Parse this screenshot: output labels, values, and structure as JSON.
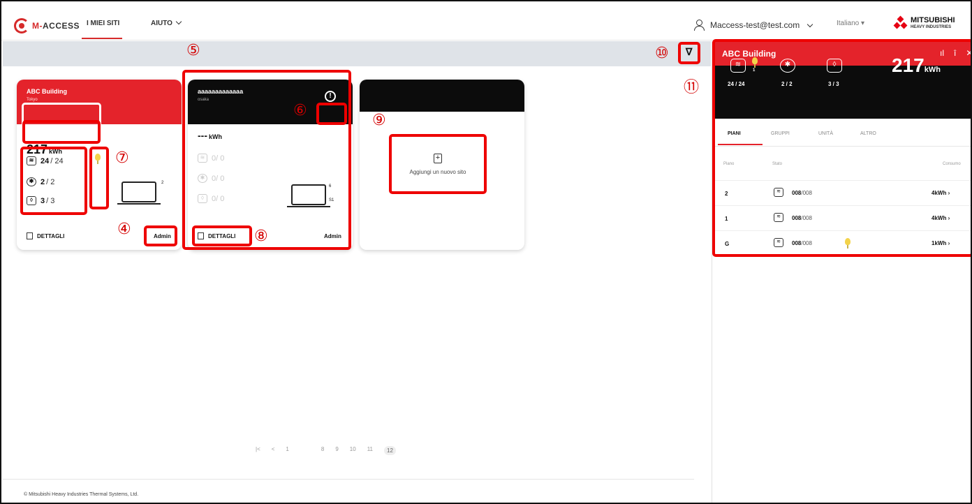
{
  "app": {
    "logo_prefix": "M-",
    "logo_word": "ACCESS"
  },
  "nav": {
    "sites": "I MIEI SITI",
    "help": "AIUTO"
  },
  "header": {
    "user_email": "Maccess-test@test.com",
    "language": "Italiano",
    "brand_main": "MITSUBISHI",
    "brand_sub": "HEAVY INDUSTRIES"
  },
  "cards": [
    {
      "name": "ABC Building",
      "subtitle": "Tokyo",
      "energy": "217",
      "energy_unit": "kWh",
      "rows": [
        {
          "num": "24",
          "den": " / 24"
        },
        {
          "num": "2",
          "den": " / 2"
        },
        {
          "num": "3",
          "den": " / 3"
        }
      ],
      "device_label": "2",
      "details": "DETTAGLI",
      "role": "Admin"
    },
    {
      "name": "aaaaaaaaaaaaa",
      "subtitle": "osaka",
      "energy": "---",
      "energy_unit": "kWh",
      "rows": [
        {
          "num": "0",
          "den": " / 0"
        },
        {
          "num": "0",
          "den": " / 0"
        },
        {
          "num": "0",
          "den": " / 0"
        }
      ],
      "device_top": "6",
      "device_bottom": "S1",
      "details": "DETTAGLI",
      "role": "Admin"
    }
  ],
  "add_site": {
    "label": "Aggiungi un nuovo sito"
  },
  "pagination": {
    "first": "|<",
    "prev": "<",
    "pages": [
      "1",
      "8",
      "9",
      "10",
      "11",
      "12"
    ],
    "current": "12"
  },
  "footer": {
    "copyright": "© Mitsubishi Heavy Industries Thermal Systems, Ltd."
  },
  "annotations": [
    "⑤",
    "⑥",
    "⑦",
    "④",
    "⑧",
    "⑨",
    "⑩",
    "⑪"
  ],
  "panel": {
    "title": "ABC Building",
    "alert_count": "1",
    "stats": [
      {
        "value": "24 / 24"
      },
      {
        "value": "2 / 2"
      },
      {
        "value": "3 / 3"
      }
    ],
    "energy": "217",
    "energy_unit": "kWh",
    "tabs": [
      "PIANI",
      "GRUPPI",
      "UNITÀ",
      "ALTRO"
    ],
    "columns": {
      "floor": "Piano",
      "state": "Stato",
      "consumption": "Consumo"
    },
    "rows": [
      {
        "floor": "2",
        "num": "008",
        "den": "/008",
        "consumption": "4kWh"
      },
      {
        "floor": "1",
        "num": "008",
        "den": "/008",
        "consumption": "4kWh"
      },
      {
        "floor": "G",
        "num": "008",
        "den": "/008",
        "consumption": "1kWh"
      }
    ]
  },
  "colors": {
    "accent_red": "#e4232b",
    "highlight": "#e00000",
    "bulb": "#f3d34a"
  },
  "icons": [
    "user-icon",
    "chevron-down-icon",
    "filter-icon",
    "alert-icon",
    "bulb-icon",
    "building-icon",
    "add-site-icon",
    "chart-icon",
    "trash-icon",
    "close-icon",
    "aircon-icon",
    "fan-icon",
    "water-icon"
  ]
}
